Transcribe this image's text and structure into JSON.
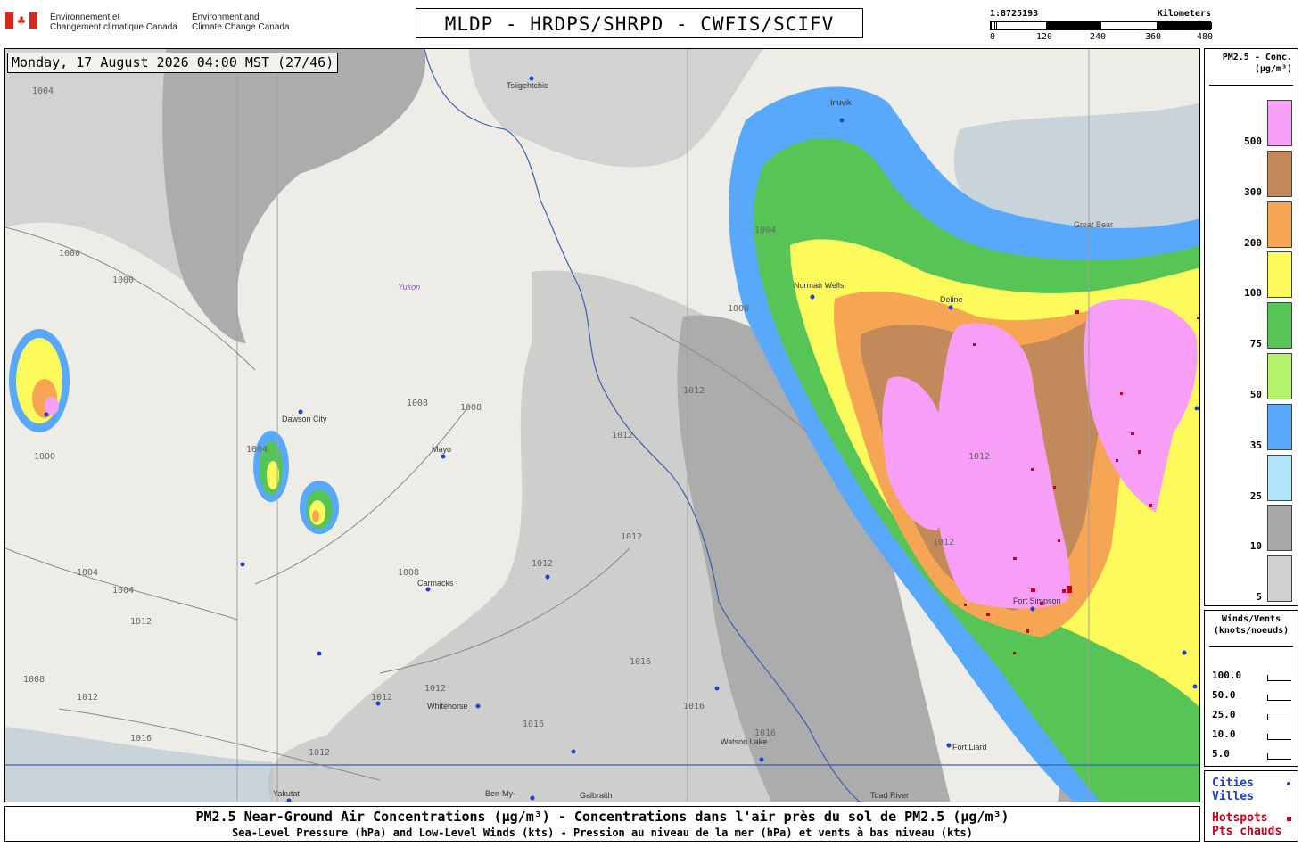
{
  "header": {
    "dept_fr": [
      "Environnement et",
      "Changement climatique Canada"
    ],
    "dept_en": [
      "Environment and",
      "Climate Change Canada"
    ],
    "title": "MLDP - HRDPS/SHRPD - CWFIS/SCIFV"
  },
  "scale": {
    "ratio": "1:8725193",
    "unit": "Kilometers",
    "ticks": [
      "0",
      "120",
      "240",
      "360",
      "480"
    ]
  },
  "timestamp": "Monday, 17 August 2026 04:00 MST (27/46)",
  "legend": {
    "title": [
      "PM2.5 - Conc.",
      "(µg/m³)"
    ],
    "levels": [
      {
        "label": "500",
        "color": "#f79ef7"
      },
      {
        "label": "300",
        "color": "#c28a5a"
      },
      {
        "label": "200",
        "color": "#f6a554"
      },
      {
        "label": "100",
        "color": "#fdfa5c"
      },
      {
        "label": "75",
        "color": "#56c556"
      },
      {
        "label": "50",
        "color": "#b3f26b"
      },
      {
        "label": "35",
        "color": "#58a9fb"
      },
      {
        "label": "25",
        "color": "#b0e4fb"
      },
      {
        "label": "10",
        "color": "#a9a9a9"
      },
      {
        "label": "5",
        "color": "#d1d1d1"
      }
    ]
  },
  "winds": {
    "title": [
      "Winds/Vents",
      "(knots/noeuds)"
    ],
    "rows": [
      "100.0",
      "50.0",
      "25.0",
      "10.0",
      "5.0"
    ]
  },
  "markers": {
    "cities": [
      "Cities",
      "Villes"
    ],
    "hotspots": [
      "Hotspots",
      "Pts chauds"
    ],
    "city_color": "#1f3fd1",
    "hotspot_color": "#c8001e"
  },
  "footer": {
    "line1": "PM2.5 Near-Ground Air Concentrations (µg/m³) - Concentrations dans l'air près du sol de PM2.5 (µg/m³)",
    "line2": "Sea-Level Pressure (hPa) and Low-Level Winds (kts) - Pression au niveau de la mer (hPa) et vents à bas niveau (kts)"
  },
  "map_labels": {
    "places": [
      "Tsiigehtchic",
      "Inuvik",
      "Yukon",
      "Dawson City",
      "Mayo",
      "Carmacks",
      "Whitehorse",
      "Watson Lake",
      "Fort Liard",
      "Yakutat",
      "Ben-My-",
      "Galbraith",
      "Toad River",
      "Fort Simpson",
      "Deline",
      "Norman Wells",
      "Great Bear"
    ],
    "isobars": [
      "1000",
      "1004",
      "1008",
      "1012",
      "1016"
    ]
  }
}
